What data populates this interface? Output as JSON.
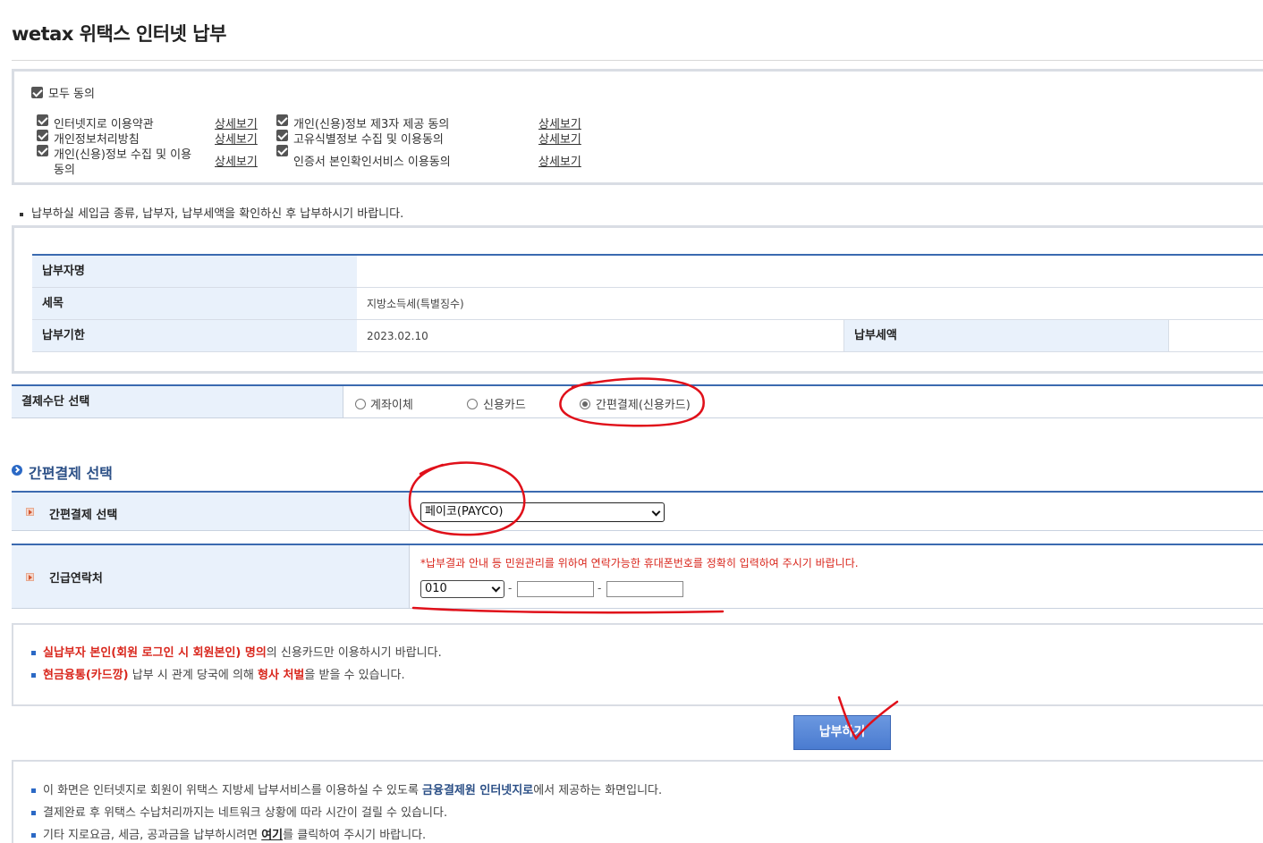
{
  "page": {
    "title": "wetax 위택스 인터넷 납부"
  },
  "agree": {
    "all_label": "모두 동의",
    "items_left": [
      {
        "label": "인터넷지로 이용약관",
        "link": "상세보기"
      },
      {
        "label": "개인정보처리방침",
        "link": "상세보기"
      },
      {
        "label": "개인(신용)정보 수집 및 이용",
        "label2": "동의",
        "link": "상세보기"
      }
    ],
    "items_right": [
      {
        "label": "개인(신용)정보 제3자 제공 동의",
        "link": "상세보기"
      },
      {
        "label": "고유식별정보 수집 및 이용동의",
        "link": "상세보기"
      },
      {
        "label": "인증서 본인확인서비스 이용동의",
        "link": "상세보기"
      }
    ]
  },
  "notice": "납부하실 세입금 종류, 납부자, 납부세액을 확인하신 후 납부하시기 바랍니다.",
  "info": {
    "payer_label": "납부자명",
    "payer_value": "",
    "tax_label": "세목",
    "tax_value": "지방소득세(특별징수)",
    "due_label": "납부기한",
    "due_value": "2023.02.10",
    "amount_label": "납부세액",
    "amount_value": ""
  },
  "payment_method": {
    "label": "결제수단 선택",
    "options": [
      "계좌이체",
      "신용카드",
      "간편결제(신용카드)"
    ],
    "selected_index": 2
  },
  "easy_pay": {
    "section_title": "간편결제 선택",
    "select_label": "간편결제 선택",
    "select_value": "페이코(PAYCO)",
    "contact_label": "긴급연락처",
    "contact_note": "*납부결과 안내 등 민원관리를 위하여 연락가능한 휴대폰번호를 정확히 입력하여 주시기 바랍니다.",
    "phone_prefix": "010",
    "phone_mid": "",
    "phone_last": "",
    "dash": "-"
  },
  "warnings": {
    "w1_red": "실납부자 본인(회원 로그인 시 회원본인) 명의",
    "w1_rest": "의 신용카드만 이용하시기 바랍니다.",
    "w2_red": "현금융통(카드깡)",
    "w2_mid": " 납부 시 관계 당국에 의해 ",
    "w2_red2": "형사 처벌",
    "w2_rest": "을 받을 수 있습니다."
  },
  "pay_button": "납부하기",
  "footer": {
    "f1_pre": "이 화면은 인터넷지로 회원이 위택스 지방세 납부서비스를 이용하실 수 있도록 ",
    "f1_blue": "금융결제원 인터넷지로",
    "f1_post": "에서 제공하는 화면입니다.",
    "f2": "결제완료 후 위택스 수납처리까지는 네트워크 상황에 따라 시간이 걸릴 수 있습니다.",
    "f3_pre": "기타 지로요금, 세금, 공과금을 납부하시려면 ",
    "f3_link": "여기",
    "f3_post": "를 클릭하여 주시기 바랍니다."
  },
  "colors": {
    "accent_blue": "#3b6ab0",
    "header_bg": "#e9f1fb",
    "warning_red": "#d9261c",
    "annotation_red": "#e0101a"
  }
}
